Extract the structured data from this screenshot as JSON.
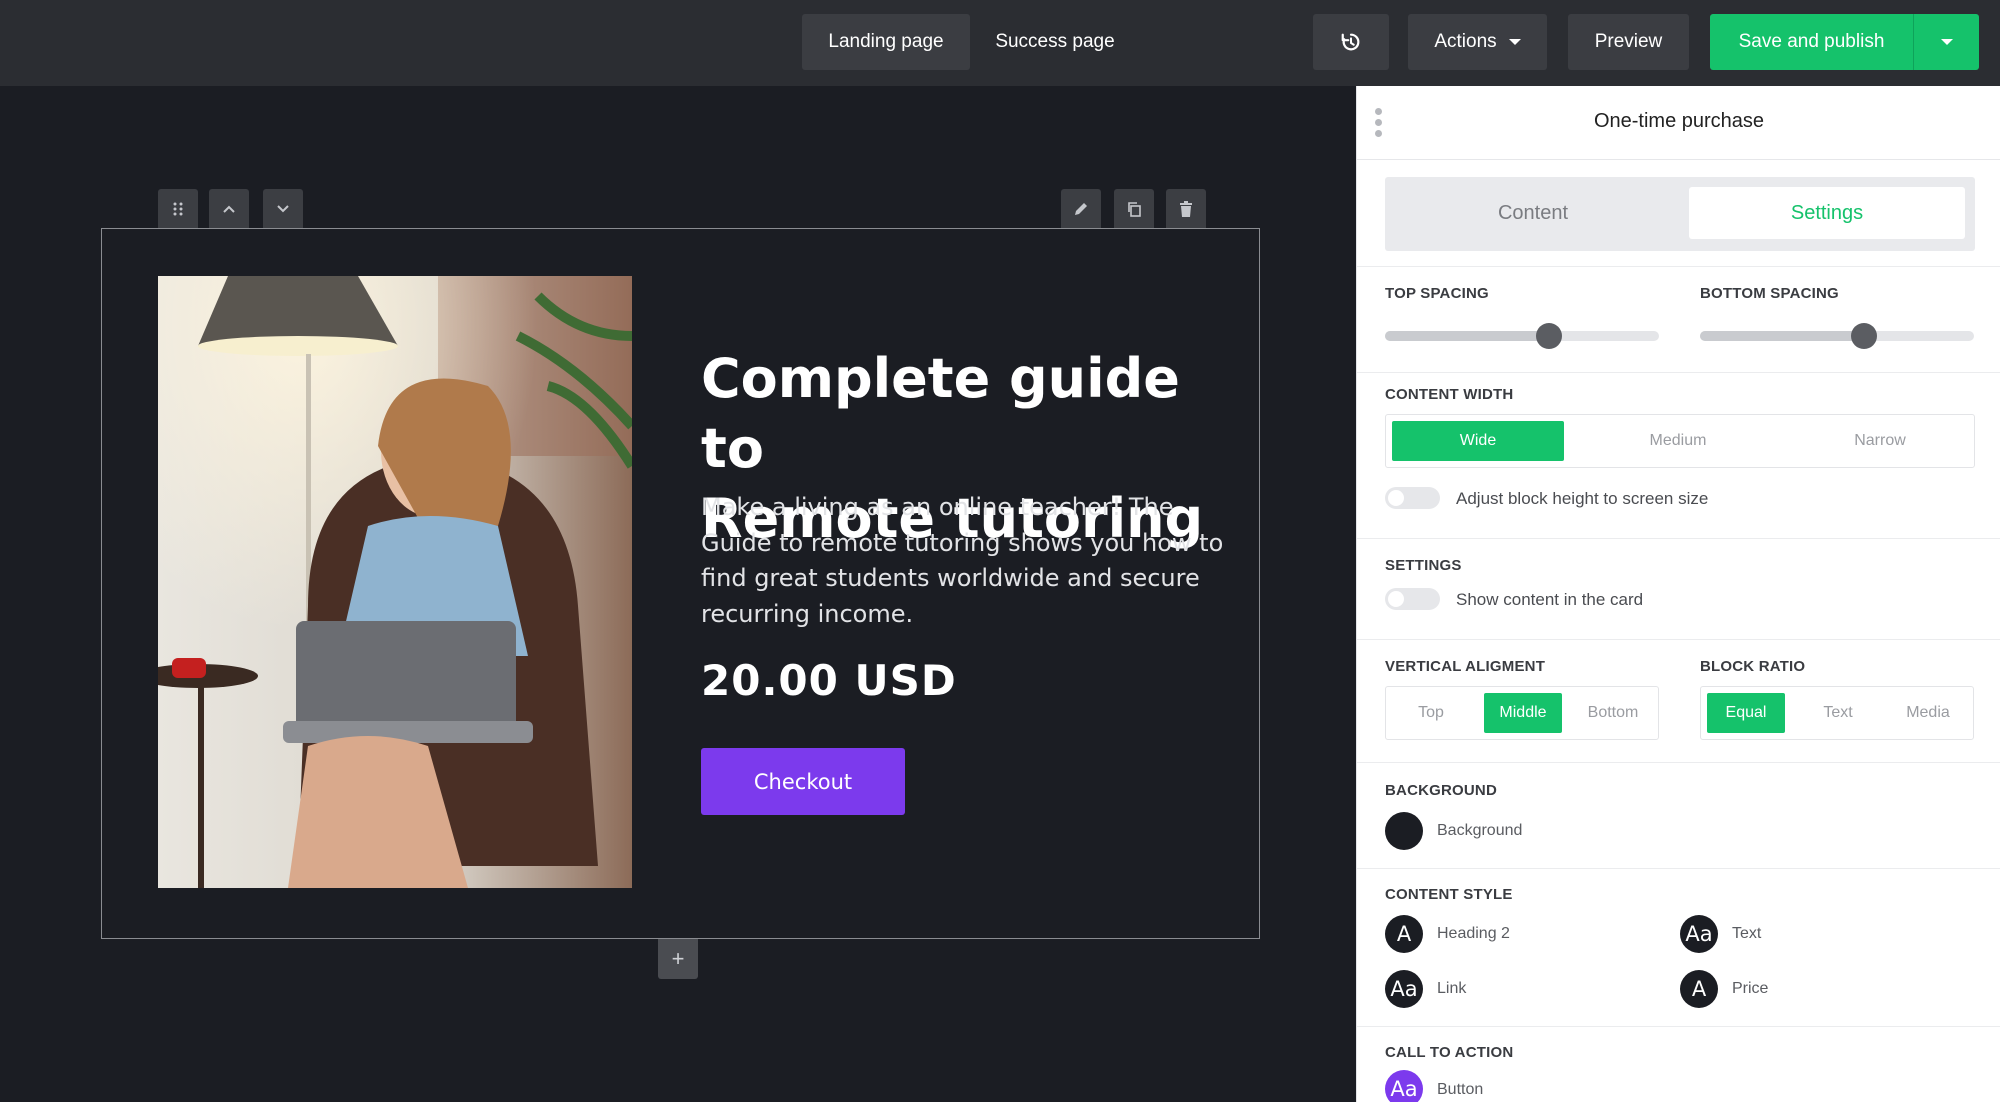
{
  "topbar": {
    "tabs": [
      "Landing page",
      "Success page"
    ],
    "actions_label": "Actions",
    "preview_label": "Preview",
    "publish_label": "Save and publish"
  },
  "block": {
    "headline_line1": "Complete guide to",
    "headline_line2": "Remote tutoring",
    "description": "Make a living as an online teacher! The Guide to remote tutoring shows you how to find great students worldwide and secure recurring income.",
    "price": "20.00 USD",
    "cta": "Checkout"
  },
  "panel": {
    "title": "One-time purchase",
    "tabs": {
      "content": "Content",
      "settings": "Settings",
      "active": "settings"
    },
    "top_spacing": {
      "label": "TOP SPACING",
      "value": 0.6
    },
    "bottom_spacing": {
      "label": "BOTTOM SPACING",
      "value": 0.6
    },
    "content_width": {
      "label": "CONTENT WIDTH",
      "options": [
        "Wide",
        "Medium",
        "Narrow"
      ],
      "selected": "Wide"
    },
    "adjust_height": {
      "label": "Adjust block height to screen size",
      "on": false
    },
    "settings": {
      "label": "SETTINGS",
      "show_in_card": {
        "label": "Show content in the card",
        "on": false
      }
    },
    "vertical_alignment": {
      "label": "VERTICAL ALIGMENT",
      "options": [
        "Top",
        "Middle",
        "Bottom"
      ],
      "selected": "Middle"
    },
    "block_ratio": {
      "label": "BLOCK RATIO",
      "options": [
        "Equal",
        "Text",
        "Media"
      ],
      "selected": "Equal"
    },
    "background": {
      "label": "BACKGROUND",
      "swatch_label": "Background",
      "color": "#1b1d23"
    },
    "content_style": {
      "label": "CONTENT STYLE",
      "items": [
        {
          "label": "Heading 2",
          "glyph": "A"
        },
        {
          "label": "Text",
          "glyph": "Aa"
        },
        {
          "label": "Link",
          "glyph": "Aa"
        },
        {
          "label": "Price",
          "glyph": "A"
        }
      ]
    },
    "call_to_action": {
      "label": "CALL TO ACTION",
      "button_label": "Button",
      "glyph": "Aa"
    }
  },
  "colors": {
    "accent": "#15c26b",
    "cta": "#7c3aed",
    "canvas": "#1b1d23",
    "topbar": "#2b2d32"
  }
}
